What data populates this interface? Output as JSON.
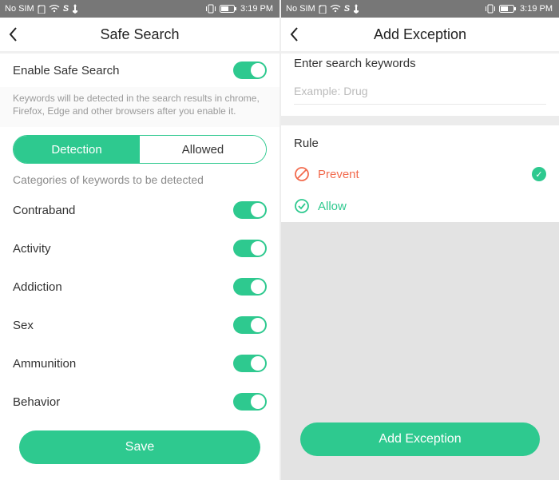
{
  "status": {
    "nosim": "No SIM",
    "time": "3:19 PM"
  },
  "left": {
    "title": "Safe Search",
    "enable": "Enable Safe Search",
    "hint": "Keywords will be detected in the search results in chrome, Firefox, Edge and other browsers after you enable it.",
    "tab_detect": "Detection",
    "tab_allowed": "Allowed",
    "subhead": "Categories of keywords to be detected",
    "categories": [
      "Contraband",
      "Activity",
      "Addiction",
      "Sex",
      "Ammunition",
      "Behavior"
    ],
    "save": "Save"
  },
  "right": {
    "title": "Add Exception",
    "field_label": "Enter search keywords",
    "placeholder": "Example: Drug",
    "rule_label": "Rule",
    "prevent": "Prevent",
    "allow": "Allow",
    "button": "Add Exception"
  }
}
